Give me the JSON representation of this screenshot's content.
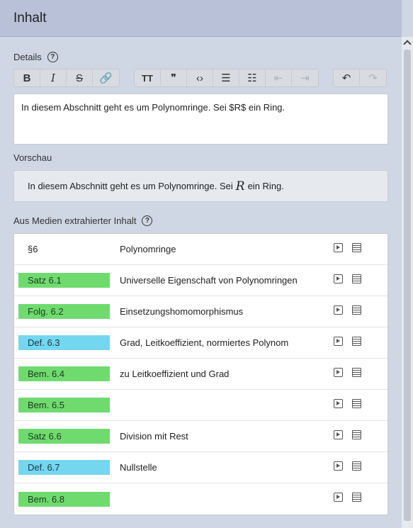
{
  "header": {
    "title": "Inhalt"
  },
  "details": {
    "label": "Details",
    "help": "?"
  },
  "toolbar": {
    "groups": [
      [
        {
          "name": "bold",
          "glyph": "B"
        },
        {
          "name": "italic",
          "glyph": "I"
        },
        {
          "name": "strikethrough",
          "glyph": "S"
        },
        {
          "name": "link",
          "glyph": "🔗"
        }
      ],
      [
        {
          "name": "heading",
          "glyph": "TT"
        },
        {
          "name": "quote",
          "glyph": "❞"
        },
        {
          "name": "code",
          "glyph": "‹›"
        },
        {
          "name": "bullet-list",
          "glyph": "☰"
        },
        {
          "name": "numbered-list",
          "glyph": "☷"
        },
        {
          "name": "outdent",
          "glyph": "⇤"
        },
        {
          "name": "indent",
          "glyph": "⇥"
        }
      ],
      [
        {
          "name": "undo",
          "glyph": "↶"
        },
        {
          "name": "redo",
          "glyph": "↷"
        }
      ]
    ]
  },
  "editor": {
    "text": "In diesem Abschnitt geht es um Polynomringe. Sei $R$ ein Ring."
  },
  "preview": {
    "label": "Vorschau",
    "before": "In diesem Abschnitt geht es um Polynomringe. Sei",
    "math": "R",
    "after": "ein Ring."
  },
  "media": {
    "label": "Aus Medien extrahierter Inhalt",
    "help": "?",
    "rows": [
      {
        "tag": "§6",
        "style": "plain",
        "title": "Polynomringe"
      },
      {
        "tag": "Satz 6.1",
        "style": "green",
        "title": "Universelle Eigenschaft von Polynomringen"
      },
      {
        "tag": "Folg. 6.2",
        "style": "green",
        "title": "Einsetzungshomomorphismus"
      },
      {
        "tag": "Def. 6.3",
        "style": "blue",
        "title": "Grad, Leitkoeffizient, normiertes Polynom"
      },
      {
        "tag": "Bem. 6.4",
        "style": "green",
        "title": "zu Leitkoeffizient und Grad"
      },
      {
        "tag": "Bem. 6.5",
        "style": "green",
        "title": ""
      },
      {
        "tag": "Satz 6.6",
        "style": "green",
        "title": "Division mit Rest"
      },
      {
        "tag": "Def. 6.7",
        "style": "blue",
        "title": "Nullstelle"
      },
      {
        "tag": "Bem. 6.8",
        "style": "green",
        "title": ""
      }
    ]
  },
  "colors": {
    "green": "#6fdb6f",
    "blue": "#74d6ef",
    "header": "#b8c1d7"
  }
}
